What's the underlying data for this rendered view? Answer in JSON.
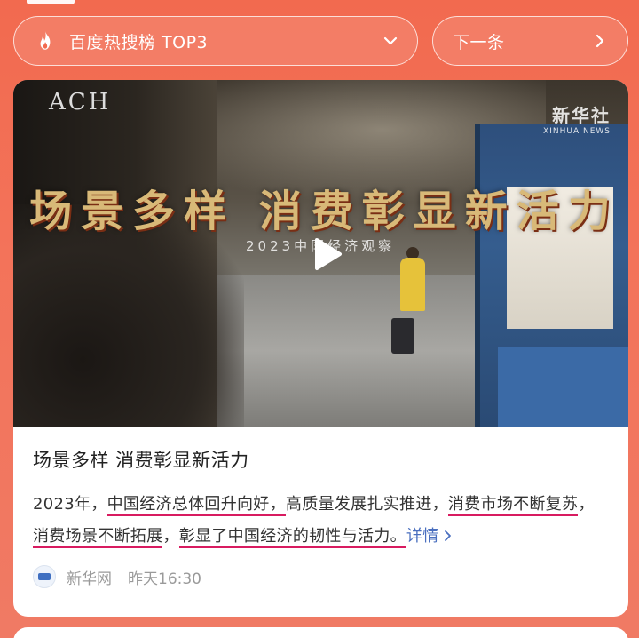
{
  "hot_rank": {
    "label": "百度热搜榜 TOP3"
  },
  "next": {
    "label": "下一条"
  },
  "video": {
    "title_overlay": "场景多样 消费彰显新活力",
    "subtitle_overlay": "2023中国经济观察",
    "watermark_cn": "新华社",
    "watermark_en": "XINHUA NEWS",
    "store_sign": "ACH"
  },
  "article": {
    "title": "场景多样 消费彰显新活力",
    "summary_parts": [
      "2023年，",
      "中国经济总体回升向好，",
      "高质量发展扎实推进，",
      "消费市场不断复苏",
      "，",
      "消费场景不断拓展",
      "，",
      "彰显了中国经济的韧性与活力。"
    ],
    "detail_label": "详情"
  },
  "source": {
    "name": "新华网",
    "time": "昨天16:30"
  },
  "colors": {
    "accent": "#f26a4f",
    "highlight": "#d81b60",
    "link": "#4a6fbf"
  }
}
